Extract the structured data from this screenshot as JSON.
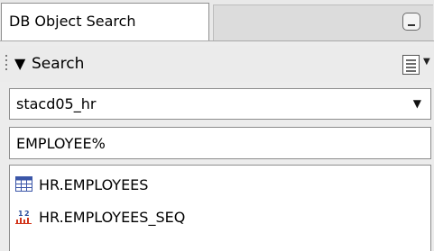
{
  "tab": {
    "title": "DB Object Search"
  },
  "search": {
    "title": "Search"
  },
  "schema_select": {
    "value": "stacd05_hr"
  },
  "filter": {
    "value": "EMPLOYEE%"
  },
  "results": [
    {
      "label": "HR.EMPLOYEES",
      "icon": "table-icon"
    },
    {
      "label": "HR.EMPLOYEES_SEQ",
      "icon": "sequence-icon"
    }
  ],
  "colors": {
    "panel_bg": "#ececec",
    "border": "#8d8d8d",
    "table_icon_blue": "#3b56a8",
    "sequence_icon_blue": "#2c4f9c",
    "sequence_icon_red": "#d2351b"
  }
}
